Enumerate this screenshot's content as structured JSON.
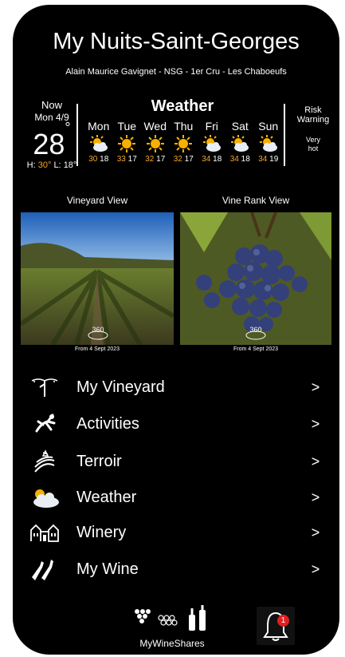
{
  "header": {
    "title": "My Nuits-Saint-Georges",
    "subtitle": "Alain  Maurice Gavignet - NSG - 1er Cru -  Les Chaboeufs"
  },
  "now": {
    "label": "Now",
    "date": "Mon 4/9",
    "temp": "28",
    "degree": "°",
    "high_label": "H:",
    "high": "30°",
    "low_label": "L:",
    "low": "18°"
  },
  "weather": {
    "title": "Weather",
    "days": [
      {
        "name": "Mon",
        "icon": "partly-cloudy-icon",
        "high": "30",
        "low": "18"
      },
      {
        "name": "Tue",
        "icon": "sun-icon",
        "high": "33",
        "low": "17"
      },
      {
        "name": "Wed",
        "icon": "sun-icon",
        "high": "32",
        "low": "17"
      },
      {
        "name": "Thu",
        "icon": "sun-icon",
        "high": "32",
        "low": "17"
      },
      {
        "name": "Fri",
        "icon": "partly-cloudy-icon",
        "high": "34",
        "low": "18"
      },
      {
        "name": "Sat",
        "icon": "partly-cloudy-icon",
        "high": "34",
        "low": "18"
      },
      {
        "name": "Sun",
        "icon": "partly-cloudy-icon",
        "high": "34",
        "low": "19"
      }
    ]
  },
  "risk": {
    "label_line1": "Risk",
    "label_line2": "Warning",
    "value_line1": "Very",
    "value_line2": "hot"
  },
  "views": {
    "vineyard": {
      "label": "Vineyard View",
      "badge": "360",
      "from": "From 4 Sept 2023"
    },
    "vine_rank": {
      "label": "Vine Rank View",
      "badge": "360",
      "from": "From 4 Sept 2023"
    }
  },
  "menu": [
    {
      "label": "My Vineyard",
      "icon": "vine-icon",
      "arrow": ">"
    },
    {
      "label": "Activities",
      "icon": "activities-icon",
      "arrow": ">"
    },
    {
      "label": "Terroir",
      "icon": "terroir-icon",
      "arrow": ">"
    },
    {
      "label": "Weather",
      "icon": "cloud-sun-icon",
      "arrow": ">"
    },
    {
      "label": "Winery",
      "icon": "winery-icon",
      "arrow": ">"
    },
    {
      "label": "My Wine",
      "icon": "wine-bottles-icon",
      "arrow": ">"
    }
  ],
  "footer": {
    "shares_label": "MyWineShares",
    "notification_count": "1"
  },
  "colors": {
    "accent": "#f4a52a",
    "sun": "#f8b000",
    "badge": "#e02020"
  }
}
